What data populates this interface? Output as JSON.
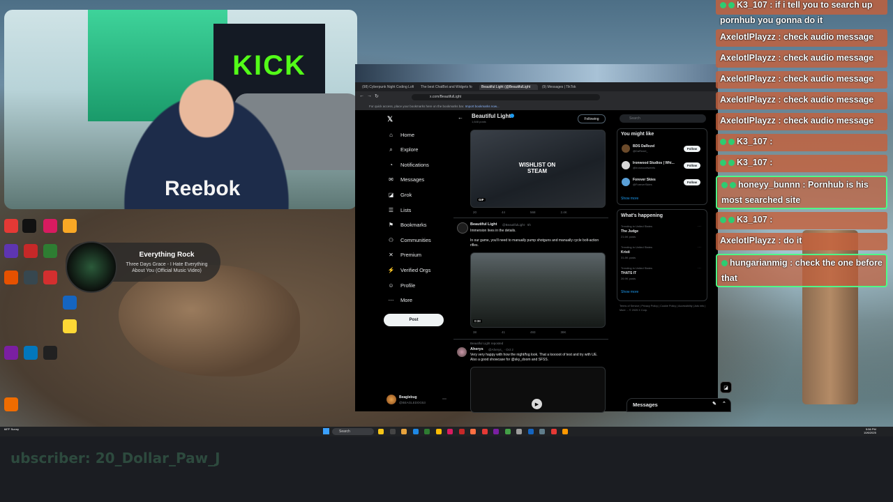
{
  "webcam": {
    "banner_text": "KICK",
    "shirt_text": "Reebok"
  },
  "desktop": {
    "icons": [
      {
        "color": "#e53935"
      },
      {
        "color": "#111111"
      },
      {
        "color": "#d81b60"
      },
      {
        "color": "#f9a825"
      },
      {
        "color": "#5e35b1"
      },
      {
        "color": "#c62828"
      },
      {
        "color": "#2e7d32"
      },
      {
        "color": "#1565c0"
      },
      {
        "color": "#e65100"
      },
      {
        "color": "#37474f"
      },
      {
        "color": "#d32f2f"
      },
      {
        "color": "#fdd835"
      },
      {
        "color": "#7b1fa2"
      },
      {
        "color": "#0277bd"
      },
      {
        "color": "#212121"
      },
      {
        "color": "#ef6c00"
      }
    ]
  },
  "now_playing": {
    "title": "Everything Rock",
    "subtitle": "Three Days Grace - I Hate Everything About You (Official Music Video)"
  },
  "browser": {
    "tabs": [
      {
        "label": "(98) Cyberpunk Night Coding Lofi",
        "active": false
      },
      {
        "label": "The best ChatBot and Widgets fo",
        "active": false
      },
      {
        "label": "Beautiful Light (@BeautifulLight",
        "active": true
      },
      {
        "label": "(9) Messages | TikTok",
        "active": false
      }
    ],
    "address": "x.com/BeautifulLight",
    "bookmarks_hint": "For quick access, place your bookmarks here on the bookmarks bar.",
    "bookmarks_link": "Import bookmarks now..."
  },
  "x_nav": {
    "items": [
      {
        "icon": "home-icon",
        "glyph": "⌂",
        "label": "Home"
      },
      {
        "icon": "explore-icon",
        "glyph": "⌕",
        "label": "Explore"
      },
      {
        "icon": "bell-icon",
        "glyph": "◔",
        "label": "Notifications"
      },
      {
        "icon": "mail-icon",
        "glyph": "✉",
        "label": "Messages"
      },
      {
        "icon": "grok-icon",
        "glyph": "◪",
        "label": "Grok"
      },
      {
        "icon": "list-icon",
        "glyph": "☰",
        "label": "Lists"
      },
      {
        "icon": "bookmark-icon",
        "glyph": "⚑",
        "label": "Bookmarks"
      },
      {
        "icon": "communities-icon",
        "glyph": "⚇",
        "label": "Communities"
      },
      {
        "icon": "premium-icon",
        "glyph": "✕",
        "label": "Premium"
      },
      {
        "icon": "verified-icon",
        "glyph": "⚡",
        "label": "Verified Orgs"
      },
      {
        "icon": "profile-icon",
        "glyph": "☺",
        "label": "Profile"
      },
      {
        "icon": "more-icon",
        "glyph": "⋯",
        "label": "More"
      }
    ],
    "post_label": "Post",
    "account_name": "Beaglebug",
    "account_handle": "@BEAGLEDOG53"
  },
  "profile": {
    "name": "Beautiful Light",
    "posts_count": "1,648 posts",
    "following_label": "Following"
  },
  "tweets": [
    {
      "media_caption": "WISHLIST ON STEAM",
      "gif_label": "GIF",
      "stats": [
        "20",
        "44",
        "568",
        "2.4K"
      ]
    },
    {
      "author": "Beautiful Light",
      "handle": "@BeautifulLight · 5h",
      "text": "Immersion lives in the details.\n\nIn our game, you'll need to manually pump shotguns and manually cycle bolt-action rifles.",
      "duration": "0:38",
      "stats": [
        "38",
        "41",
        "493",
        "38K"
      ]
    },
    {
      "repost_label": "Beautiful Light reposted",
      "author": "Aherys",
      "handle": "@Aherys_ · Oct 2",
      "text": "Very very happy with how the night/fog look. That a looooot of test and try with UE. Also a good showcase for @sky_doom and SFSS."
    }
  ],
  "right_col": {
    "search_placeholder": "Search",
    "might_like_title": "You might like",
    "suggestions": [
      {
        "name": "BDS DaRezel",
        "handle": "@DaRezel_",
        "follow": "Follow"
      },
      {
        "name": "Ironwood Studios | Whi...",
        "handle": "@Ironwoodtweets",
        "follow": "Follow"
      },
      {
        "name": "Forever Skies",
        "handle": "@ForeverSkies",
        "follow": "Follow"
      }
    ],
    "show_more": "Show more",
    "happening_title": "What's happening",
    "trends": [
      {
        "context": "Trending in United States",
        "name": "The Judge",
        "count": "21.6K posts"
      },
      {
        "context": "Trending in United States",
        "name": "Kristi",
        "count": "31.8K posts"
      },
      {
        "context": "Trending in United States",
        "name": "THATS IT",
        "count": "26.9K posts"
      }
    ],
    "show_more_2": "Show more",
    "footer": "Terms of Service | Privacy Policy | Cookie Policy | Accessibility | Ads info | More ... © 2025 X Corp.",
    "messages_label": "Messages"
  },
  "chat": [
    {
      "user": "K3_107",
      "text": ": if i tell you to search up pornhub you gonna do it",
      "badges": 2
    },
    {
      "user": "AxelotlPlayzz",
      "text": ": check audio message",
      "badges": 0
    },
    {
      "user": "AxelotlPlayzz",
      "text": ": check audio message",
      "badges": 0
    },
    {
      "user": "AxelotlPlayzz",
      "text": ": check audio message",
      "badges": 0
    },
    {
      "user": "AxelotlPlayzz",
      "text": ": check audio message",
      "badges": 0
    },
    {
      "user": "AxelotlPlayzz",
      "text": ": check audio message",
      "badges": 0
    },
    {
      "user": "K3_107",
      "text": ":",
      "badges": 2
    },
    {
      "user": "K3_107",
      "text": ":",
      "badges": 2
    },
    {
      "user": "honeyy_bunnn",
      "text": ": Pornhub is his most searched site",
      "badges": 2
    },
    {
      "user": "K3_107",
      "text": ":",
      "badges": 2
    },
    {
      "user": "AxelotlPlayzz",
      "text": ": do it",
      "badges": 0
    },
    {
      "user": "hungarianmig",
      "text": ": check the one before that",
      "badges": 1
    }
  ],
  "taskbar": {
    "search_label": "Search",
    "weather": "68°F Sunny",
    "time": "5:56 PM",
    "date": "10/6/2025"
  },
  "overlay": {
    "subscriber_text": "ubscriber: 20_Dollar_Paw_J"
  }
}
